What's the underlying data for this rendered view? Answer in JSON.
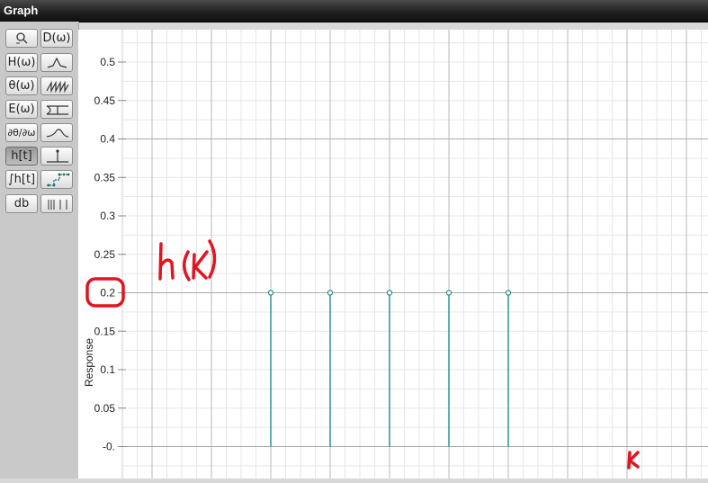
{
  "window": {
    "title": "Graph"
  },
  "toolbar": {
    "rows": [
      {
        "left": {
          "label": "",
          "icon": "zoom-icon"
        },
        "right": {
          "label": "D(ω)",
          "icon": ""
        }
      },
      {
        "left": {
          "label": "H(ω)",
          "icon": ""
        },
        "right": {
          "label": "",
          "icon": "peak-response-icon"
        }
      },
      {
        "left": {
          "label": "θ(ω)",
          "icon": ""
        },
        "right": {
          "label": "",
          "icon": "sawtooth-phase-icon"
        }
      },
      {
        "left": {
          "label": "E(ω)",
          "icon": ""
        },
        "right": {
          "label": "",
          "icon": "error-band-icon"
        }
      },
      {
        "left": {
          "label": "∂θ/∂ω",
          "icon": ""
        },
        "right": {
          "label": "",
          "icon": "group-delay-curve-icon"
        }
      },
      {
        "left": {
          "label": "h[t]",
          "icon": "",
          "active": true
        },
        "right": {
          "label": "",
          "icon": "impulse-icon"
        }
      },
      {
        "left": {
          "label": "∫h[t]",
          "icon": ""
        },
        "right": {
          "label": "",
          "icon": "step-response-icon"
        }
      },
      {
        "left": {
          "label": "db",
          "icon": ""
        },
        "right": {
          "label": "",
          "icon": "bars-icon"
        }
      }
    ]
  },
  "annotations": {
    "ylabel_handwritten": "h(k)",
    "xlabel_handwritten": "k",
    "circled_tick": "0.2",
    "ink_color": "#e0151f"
  },
  "chart_data": {
    "type": "stem",
    "ylabel": "Response",
    "yticks": [
      "0.5",
      "0.45",
      "0.4",
      "0.35",
      "0.3",
      "0.25",
      "0.2",
      "0.15",
      "0.1",
      "0.05",
      "-0."
    ],
    "ylim": [
      -0.02,
      0.53
    ],
    "xlim": [
      -3,
      3
    ],
    "x": [
      -1,
      0,
      1,
      2,
      3
    ],
    "values": [
      0.2,
      0.2,
      0.2,
      0.2,
      0.2
    ],
    "grid": true,
    "stem_color": "#1f8a8a"
  }
}
